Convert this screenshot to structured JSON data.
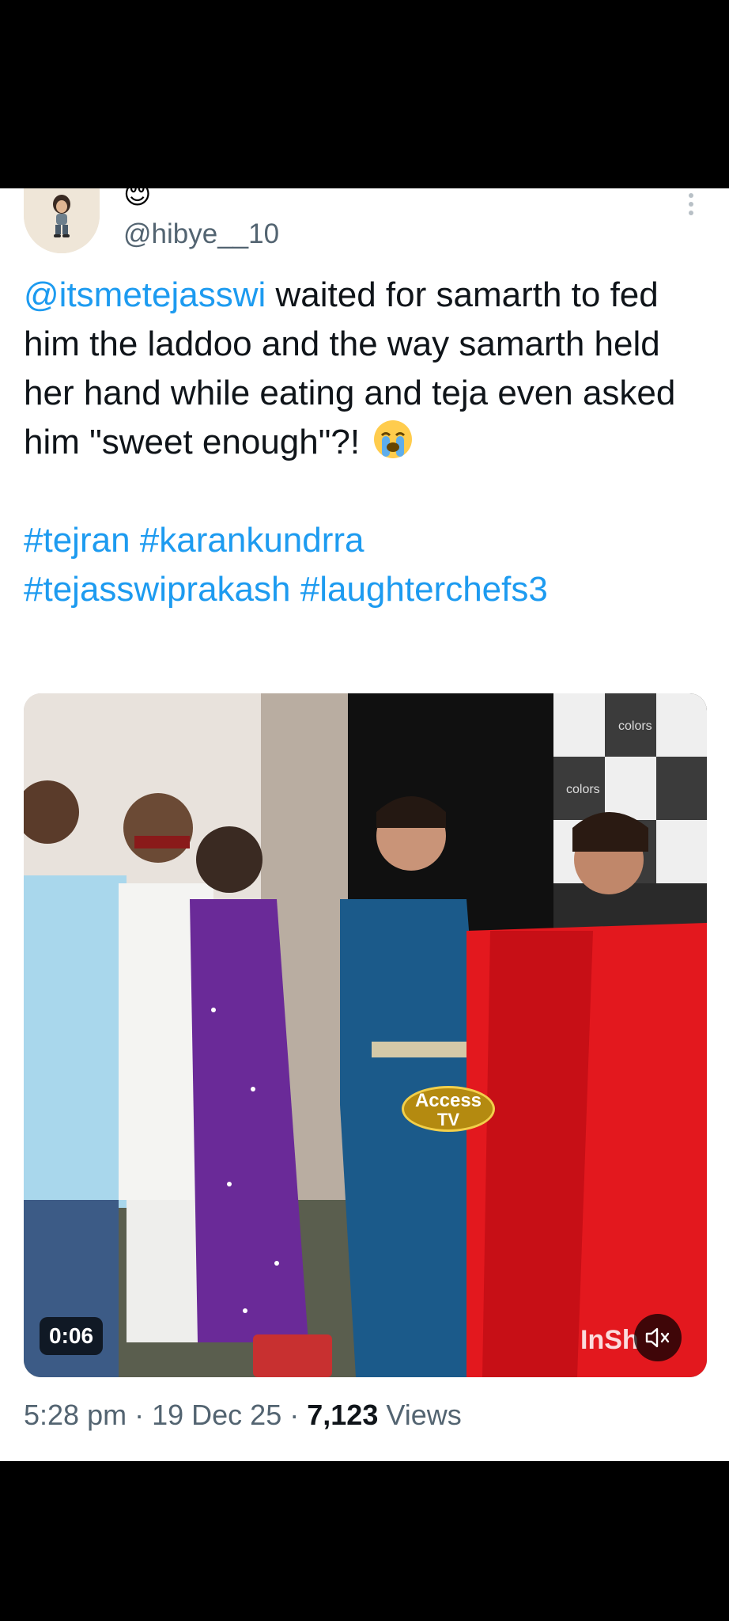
{
  "tweet": {
    "display_name_emoji": "😌",
    "handle": "@hibye__10",
    "text": {
      "mention": "@itsmetejasswi",
      "body": " waited for samarth to fed him the laddoo and the way samarth held her hand while eating and teja even asked him \"sweet enough\"?! ",
      "emoji_icon": "loudly-crying-face-icon",
      "hashtags_line1": [
        "#tejran",
        "#karankundrra"
      ],
      "hashtags_line2": [
        "#tejasswiprakash",
        "#laughterchefs3"
      ]
    },
    "media": {
      "type": "video",
      "duration": "0:06",
      "mute_icon": "speaker-muted-icon",
      "watermark_top": "Access",
      "watermark_bottom": "TV",
      "watermark_inshot": "InSh",
      "backdrop_logo_text": "colors"
    },
    "meta": {
      "time": "5:28 pm",
      "separator": "·",
      "date": "19 Dec 25",
      "views_count": "7,123",
      "views_label": "Views"
    }
  },
  "colors": {
    "link_blue": "#1d9bf0",
    "text_primary": "#0f1419",
    "text_secondary": "#536471"
  }
}
